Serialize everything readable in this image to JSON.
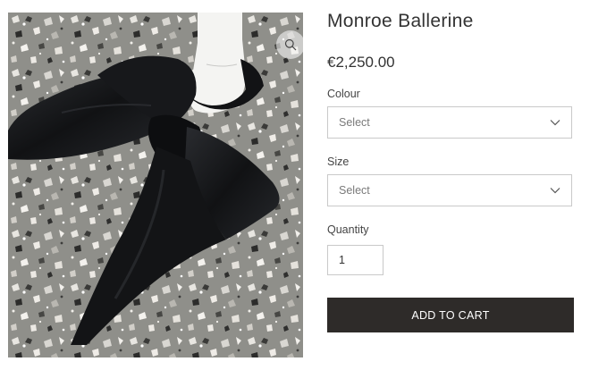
{
  "product": {
    "title": "Monroe Ballerine",
    "price": "€2,250.00",
    "image_icon": "zoom-icon"
  },
  "options": {
    "colour": {
      "label": "Colour",
      "value": "Select"
    },
    "size": {
      "label": "Size",
      "value": "Select"
    },
    "dropdown_icon": "chevron-down-icon"
  },
  "quantity": {
    "label": "Quantity",
    "value": "1"
  },
  "cart": {
    "button_label": "ADD TO CART"
  },
  "colors": {
    "button_bg": "#2e2b29",
    "bow": "#141517",
    "sock": "#f4f4f2",
    "floor": "#8f8f8a"
  }
}
